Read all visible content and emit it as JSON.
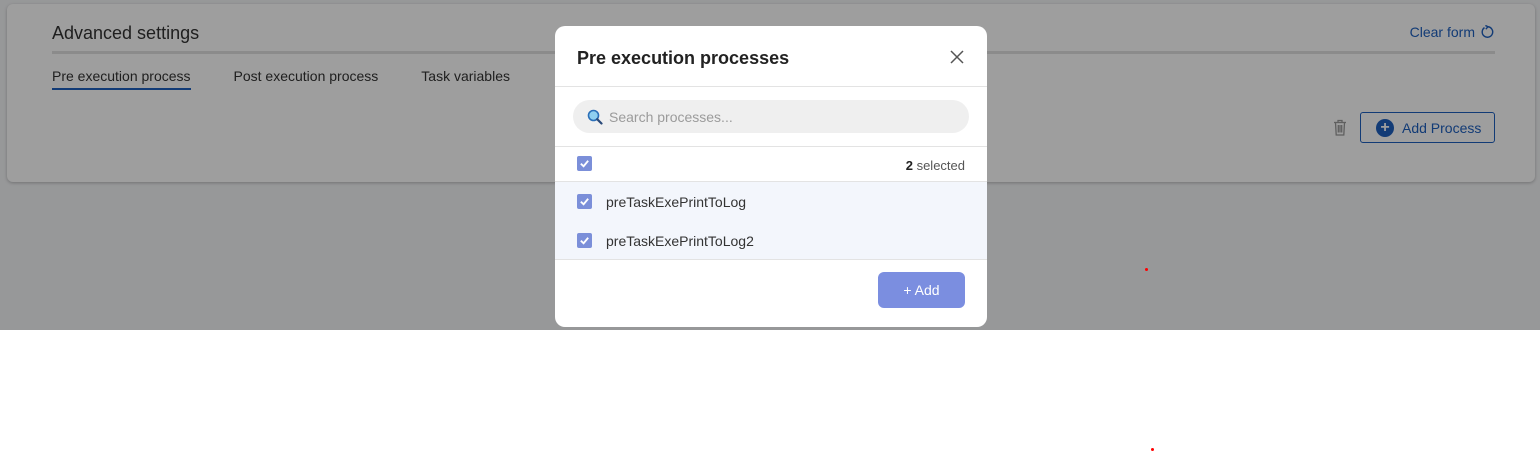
{
  "page": {
    "card_title": "Advanced settings",
    "clear_form_label": "Clear form",
    "tabs": [
      {
        "label": "Pre execution process",
        "active": true
      },
      {
        "label": "Post execution process",
        "active": false
      },
      {
        "label": "Task variables",
        "active": false
      }
    ],
    "add_process_label": "Add Process",
    "add_process_icon": "plus-circle-icon",
    "delete_icon": "trash-icon",
    "clear_form_icon": "refresh-icon"
  },
  "modal": {
    "title": "Pre execution processes",
    "close_icon": "close-icon",
    "search_placeholder": "Search processes...",
    "search_icon": "search-icon",
    "selected_count": "2",
    "selected_suffix": "selected",
    "items": [
      {
        "label": "preTaskExePrintToLog",
        "checked": true
      },
      {
        "label": "preTaskExePrintToLog2",
        "checked": true
      }
    ],
    "add_label": "+ Add"
  },
  "colors": {
    "accent": "#1d5fbf",
    "checkbox": "#7b8fd9",
    "add_button": "#7b8ee0"
  }
}
